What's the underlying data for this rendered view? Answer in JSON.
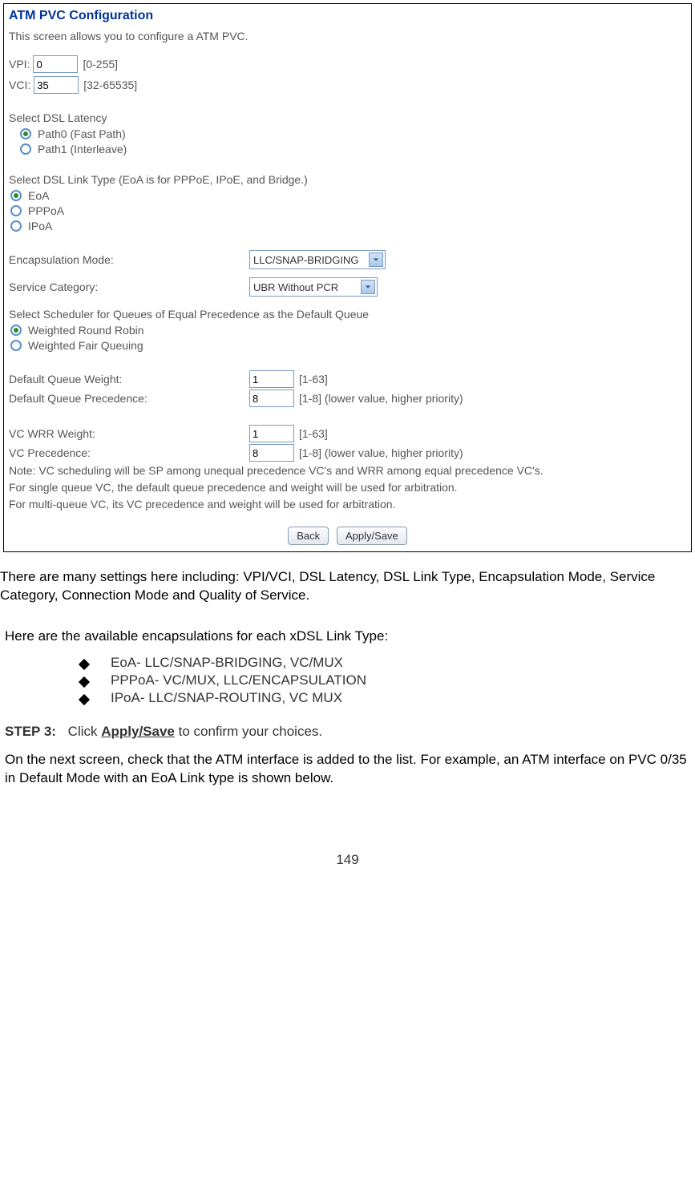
{
  "panel": {
    "title": "ATM PVC Configuration",
    "description": "This screen allows you to configure a ATM PVC.",
    "vpi": {
      "label": "VPI:",
      "value": "0",
      "hint": "[0-255]"
    },
    "vci": {
      "label": "VCI:",
      "value": "35",
      "hint": "[32-65535]"
    },
    "latency": {
      "label": "Select DSL Latency",
      "opt0": "Path0 (Fast Path)",
      "opt1": "Path1 (Interleave)"
    },
    "linktype": {
      "label": "Select DSL Link Type (EoA is for PPPoE, IPoE, and Bridge.)",
      "opt0": "EoA",
      "opt1": "PPPoA",
      "opt2": "IPoA"
    },
    "encap": {
      "label": "Encapsulation Mode:",
      "value": "LLC/SNAP-BRIDGING"
    },
    "servcat": {
      "label": "Service Category:",
      "value": "UBR Without PCR"
    },
    "sched": {
      "label": "Select Scheduler for Queues of Equal Precedence as the Default Queue",
      "opt0": "Weighted Round Robin",
      "opt1": "Weighted Fair Queuing"
    },
    "dqw": {
      "label": "Default Queue Weight:",
      "value": "1",
      "hint": "[1-63]"
    },
    "dqp": {
      "label": "Default Queue Precedence:",
      "value": "8",
      "hint": "[1-8] (lower value, higher priority)"
    },
    "vcw": {
      "label": "VC WRR Weight:",
      "value": "1",
      "hint": "[1-63]"
    },
    "vcp": {
      "label": "VC Precedence:",
      "value": "8",
      "hint": "[1-8] (lower value, higher priority)"
    },
    "note1": "Note: VC scheduling will be SP among unequal precedence VC's and WRR among equal precedence VC's.",
    "note2": "For single queue VC, the default queue precedence and weight will be used for arbitration.",
    "note3": "For multi-queue VC, its VC precedence and weight will be used for arbitration.",
    "back": "Back",
    "apply": "Apply/Save"
  },
  "doc": {
    "para1": "There are many settings here including: VPI/VCI, DSL Latency, DSL Link Type, Encapsulation Mode, Service Category, Connection Mode and Quality of Service.",
    "para2": "Here are the available encapsulations for each xDSL Link Type:",
    "b1": "EoA- LLC/SNAP-BRIDGING, VC/MUX",
    "b2": "PPPoA- VC/MUX, LLC/ENCAPSULATION",
    "b3": "IPoA- LLC/SNAP-ROUTING, VC MUX",
    "step_label": "STEP 3:",
    "step_pre": "Click ",
    "step_bold": "Apply/Save",
    "step_post": " to confirm your choices.",
    "para3": "On the next screen, check that the ATM interface is added to the list. For example, an ATM interface on PVC 0/35 in Default Mode with an EoA Link type is shown below.",
    "page_number": "149"
  }
}
